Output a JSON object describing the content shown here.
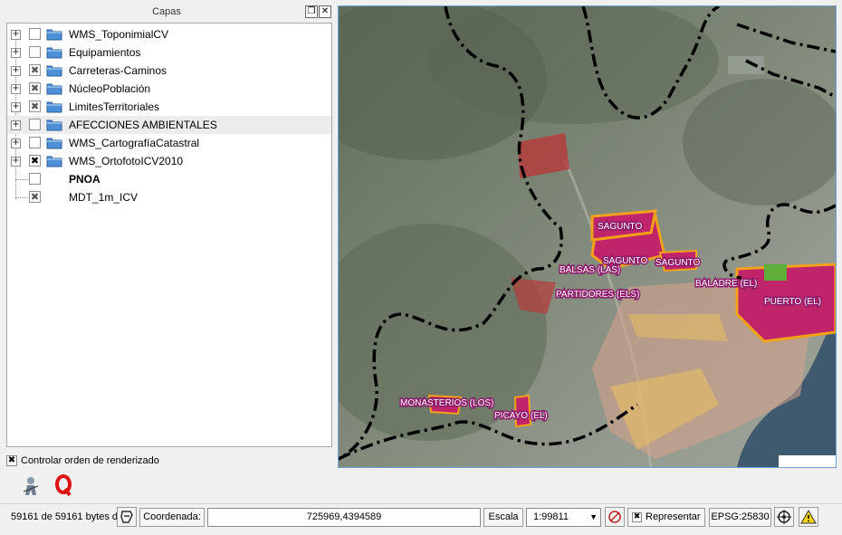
{
  "layers_panel": {
    "title": "Capas",
    "float_button_icon": "float-icon",
    "close_button_icon": "close-icon",
    "items": [
      {
        "label": "WMS_ToponimialCV",
        "checked": false,
        "expandable": true
      },
      {
        "label": "Equipamientos",
        "checked": false,
        "expandable": true
      },
      {
        "label": "Carreteras-Caminos",
        "checked": "partial",
        "expandable": true
      },
      {
        "label": "NúcleoPoblación",
        "checked": "partial",
        "expandable": true
      },
      {
        "label": "LimitesTerritoriales",
        "checked": "partial",
        "expandable": true
      },
      {
        "label": "AFECCIONES AMBIENTALES",
        "checked": false,
        "expandable": true,
        "highlighted": true
      },
      {
        "label": "WMS_CartografíaCatastral",
        "checked": false,
        "expandable": true
      },
      {
        "label": "WMS_OrtofotoICV2010",
        "checked": true,
        "expandable": true
      },
      {
        "label": "PNOA",
        "checked": false,
        "expandable": false,
        "bold": true
      },
      {
        "label": "MDT_1m_ICV",
        "checked": "partial",
        "expandable": false
      }
    ],
    "check_symbol": "✖",
    "expand_symbol": "+",
    "render_order": {
      "label": "Controlar orden de renderizado",
      "checked": true
    }
  },
  "map": {
    "place_labels": [
      "SAGUNTO",
      "SAGUNTO",
      "SAGUNTO",
      "BALSAS (LAS)",
      "PARTIDORES (ELS)",
      "BALADRE (EL)",
      "PUERTO (EL)",
      "MONASTERIOS (LOS)",
      "PICAYO (EL)"
    ],
    "colors": {
      "urban": "#c0246a",
      "urban_edge": "#f2a21a",
      "boundary": "#000000",
      "terrain": "#6f7b6a",
      "sea": "#3f5a6e",
      "highlight": "#6ba0d9"
    }
  },
  "toolbar": {
    "identify_icon": "identify-icon",
    "plugin_icon": "q-icon"
  },
  "statusbar": {
    "progress_text": "59161 de 59161 bytes d",
    "coordinate_label": "Coordenada:",
    "coordinate_value": "725969,4394589",
    "scale_label": "Escala",
    "scale_value": "1:99811",
    "render_label": "Representar",
    "render_checked": true,
    "crs": "EPSG:25830",
    "messages_icon": "warning-icon"
  }
}
